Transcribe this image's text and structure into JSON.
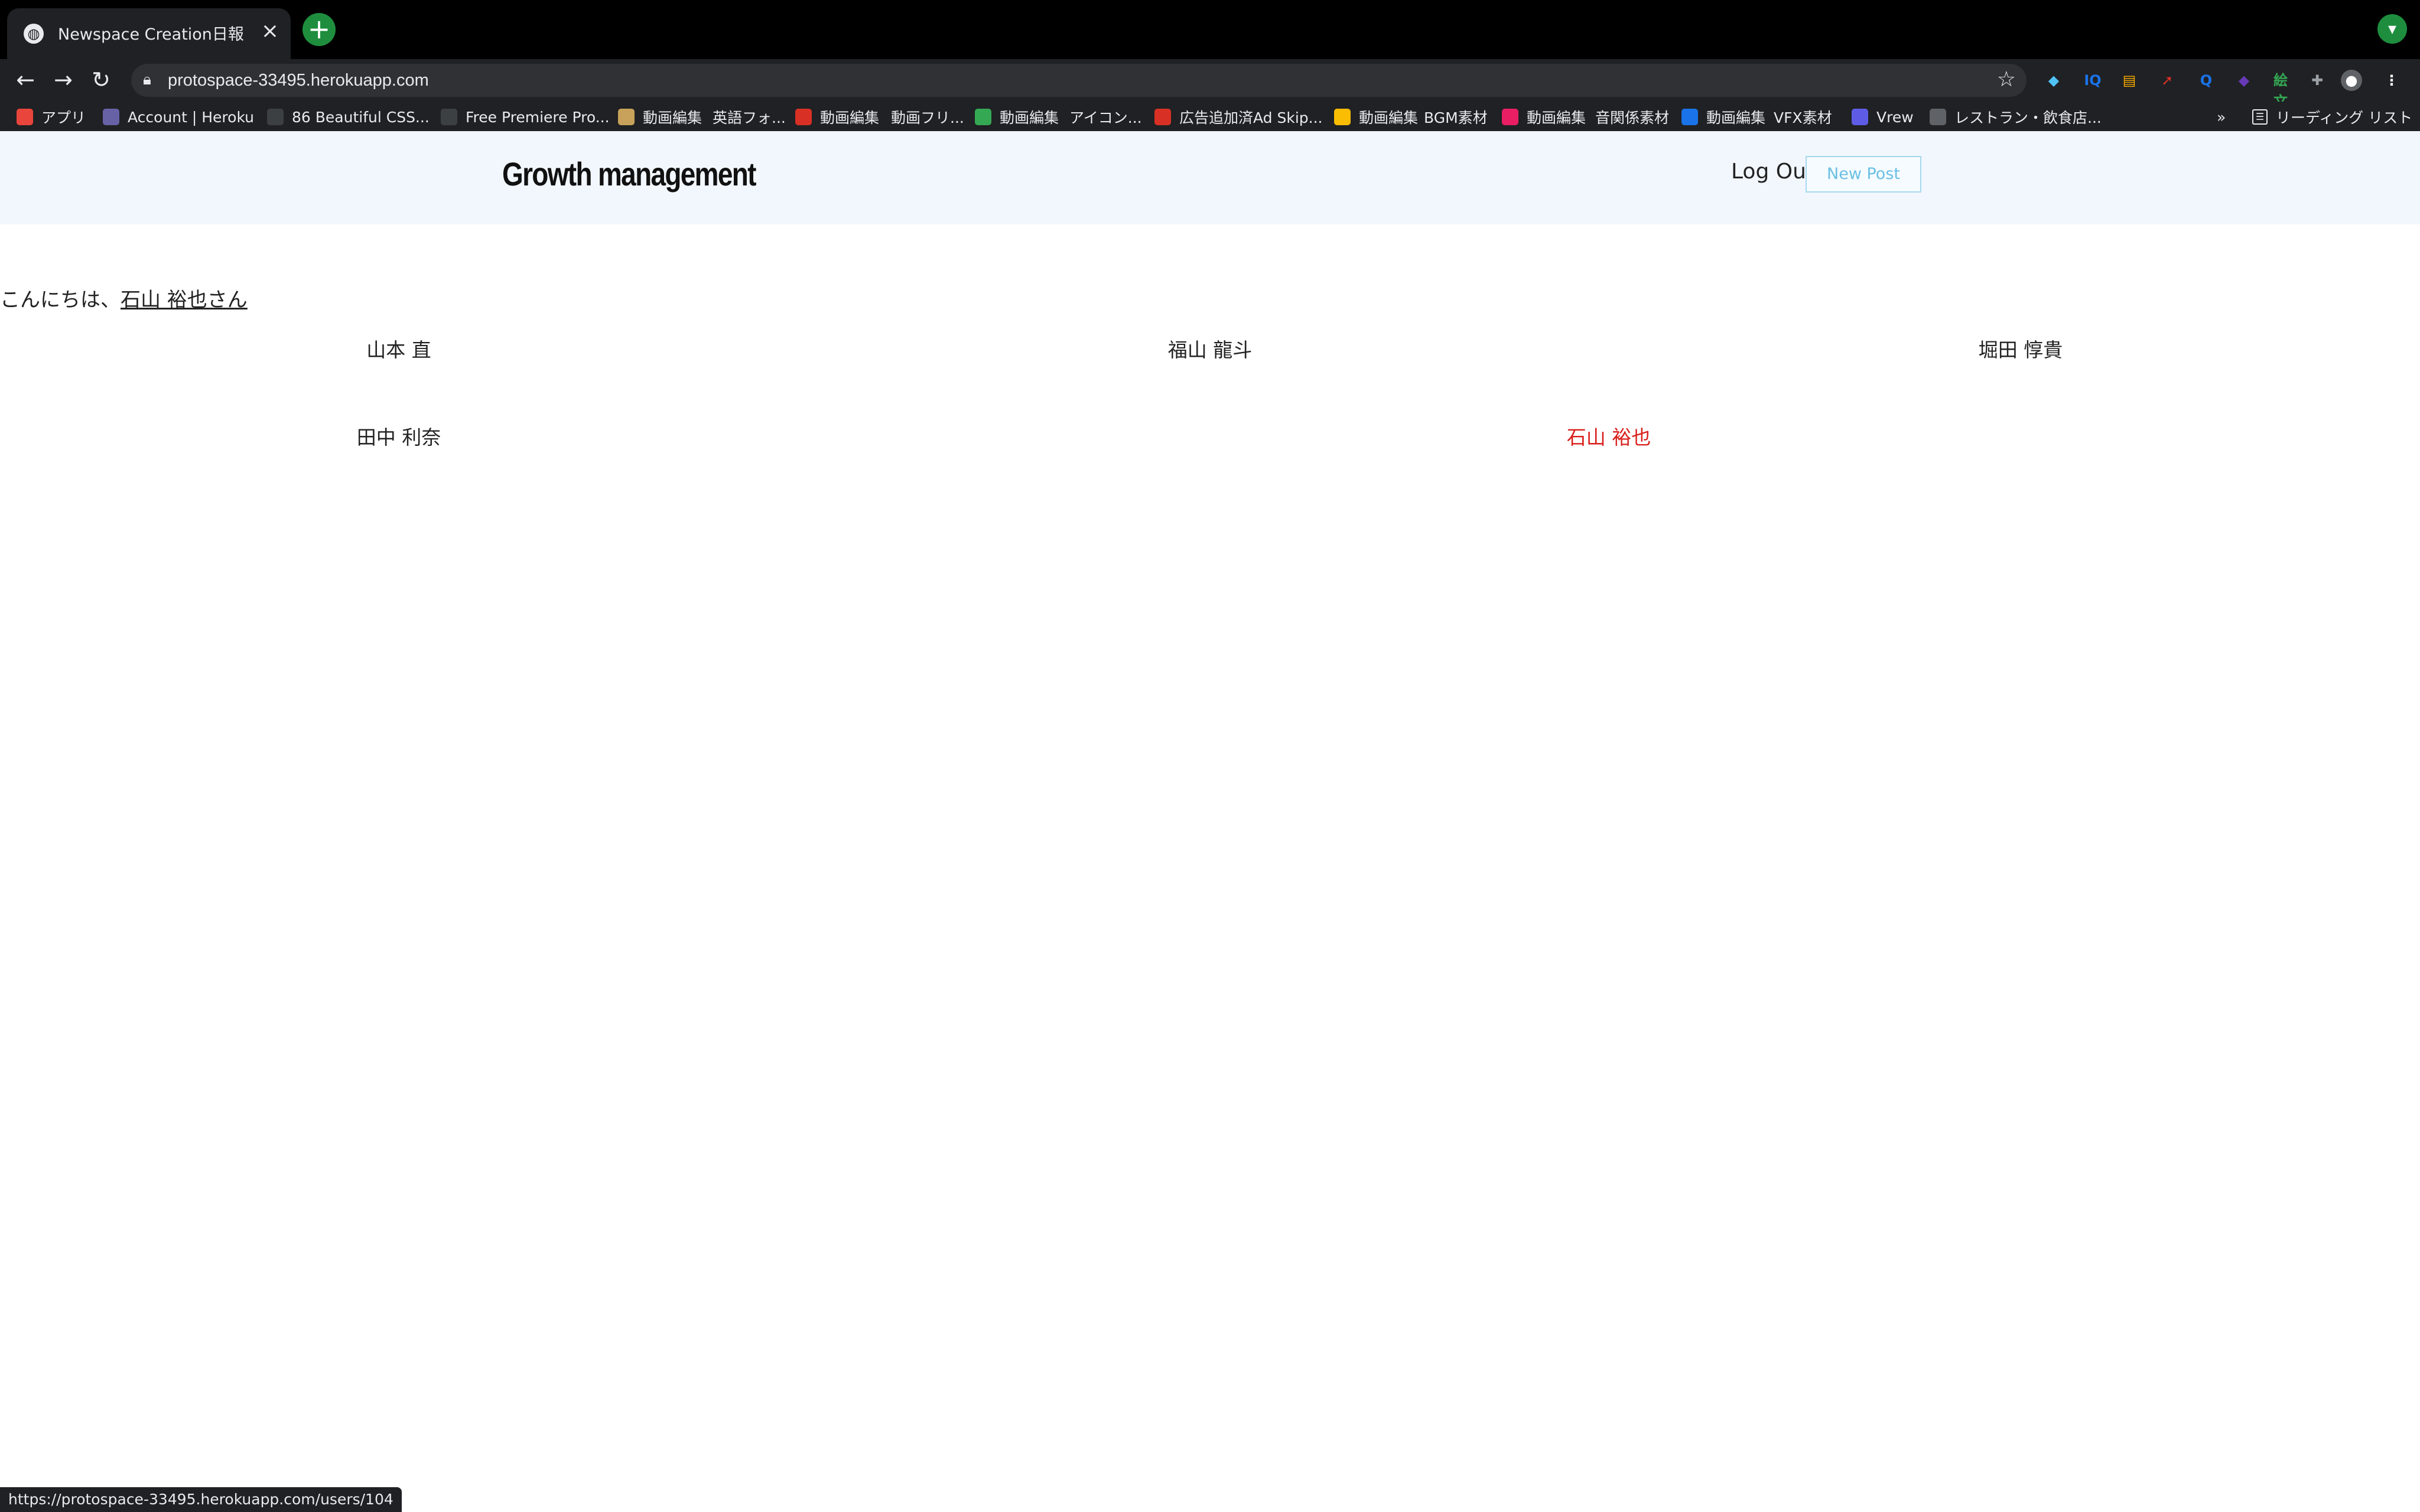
{
  "browser": {
    "tab_title": "Newspace Creation日報",
    "url": "protospace-33495.herokuapp.com",
    "status_url": "https://protospace-33495.herokuapp.com/users/104",
    "bookmarks": [
      {
        "label": "アプリ",
        "icon": "apps-grid-icon",
        "color": "#e8453c"
      },
      {
        "label": "Account | Heroku",
        "icon": "heroku-icon",
        "color": "#6762a6"
      },
      {
        "label": "86 Beautiful CSS...",
        "icon": "css-icon",
        "color": "#3c4043"
      },
      {
        "label": "Free Premiere Pro...",
        "icon": "m-icon",
        "color": "#3c4043"
      },
      {
        "label": "動画編集",
        "icon": "video-icon",
        "color": "#c8a25a"
      },
      {
        "label": "英語フォ...",
        "icon": "none",
        "color": ""
      },
      {
        "label": "動画編集",
        "icon": "m-red-icon",
        "color": "#d93025"
      },
      {
        "label": "動画フリ...",
        "icon": "none",
        "color": ""
      },
      {
        "label": "動画編集",
        "icon": "v-green-icon",
        "color": "#34a853"
      },
      {
        "label": "アイコン...",
        "icon": "none",
        "color": ""
      },
      {
        "label": "広告追加済Ad Skip...",
        "icon": "ad-icon",
        "color": "#d93025"
      },
      {
        "label": "動画編集",
        "icon": "triangle-icon",
        "color": "#fbbc04"
      },
      {
        "label": "BGM素材",
        "icon": "none",
        "color": ""
      },
      {
        "label": "動画編集",
        "icon": "pink-circle-icon",
        "color": "#e91e63"
      },
      {
        "label": "音関係素材",
        "icon": "none",
        "color": ""
      },
      {
        "label": "動画編集",
        "icon": "v-blue-icon",
        "color": "#1a73e8"
      },
      {
        "label": "VFX素材",
        "icon": "none",
        "color": ""
      },
      {
        "label": "Vrew",
        "icon": "vrew-icon",
        "color": "#5e5ce6"
      },
      {
        "label": "レストラン・飲食店...",
        "icon": "s-icon",
        "color": "#5f6368"
      }
    ],
    "more_bookmarks": "»",
    "reading_list": "リーディング リスト",
    "extensions": [
      {
        "icon": "diamond-icon",
        "glyph": "◆",
        "color": "#4fc3f7"
      },
      {
        "icon": "iq-icon",
        "glyph": "IQ",
        "color": "#1a73e8"
      },
      {
        "icon": "stack-icon",
        "glyph": "▤",
        "color": "#f9ab00"
      },
      {
        "icon": "rocket-icon",
        "glyph": "➚",
        "color": "#d93025"
      },
      {
        "icon": "search-badge-icon",
        "glyph": "Q",
        "color": "#1a73e8"
      },
      {
        "icon": "shapes-icon",
        "glyph": "◆",
        "color": "#673ab7"
      },
      {
        "icon": "translate-icon",
        "glyph": "絵文",
        "color": "#34a853"
      },
      {
        "icon": "puzzle-icon",
        "glyph": "✚",
        "color": "#9aa0a6"
      }
    ]
  },
  "header": {
    "title": "Growth management",
    "logout_label": "Log Out",
    "new_post_label": "New Post"
  },
  "greeting": {
    "prefix": "こんにちは、",
    "user_link": "石山 裕也さん"
  },
  "users": [
    {
      "name": "山本 直",
      "current": false
    },
    {
      "name": "福山 龍斗",
      "current": false
    },
    {
      "name": "堀田 惇貴",
      "current": false
    },
    {
      "name": "田中 利奈",
      "current": false
    },
    {
      "name": "石山 裕也",
      "current": true
    }
  ]
}
